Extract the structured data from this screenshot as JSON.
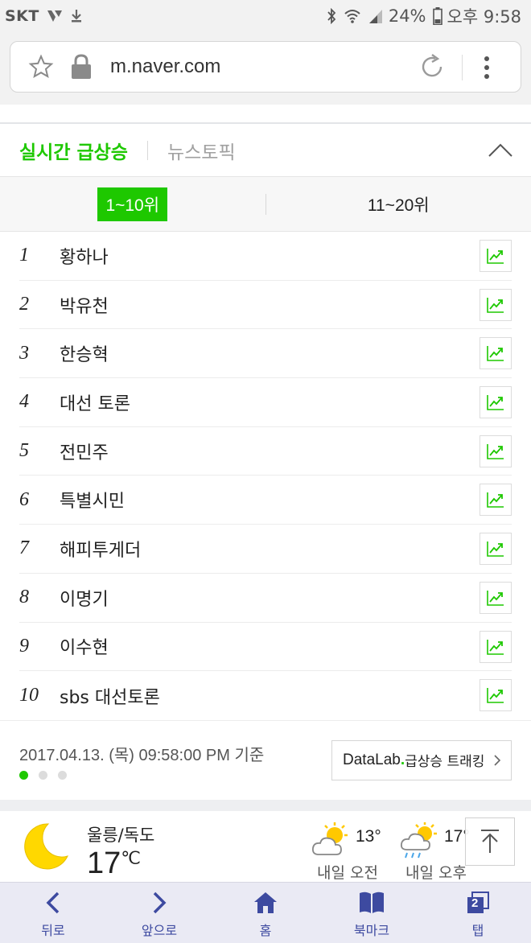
{
  "status_bar": {
    "carrier": "SKT",
    "battery": "24%",
    "time": "오후 9:58"
  },
  "browser": {
    "url": "m.naver.com"
  },
  "realtime": {
    "tab_active": "실시간 급상승",
    "tab_other": "뉴스토픽",
    "range_active": "1~10위",
    "range_other": "11~20위",
    "items": [
      {
        "rank": "1",
        "keyword": "황하나"
      },
      {
        "rank": "2",
        "keyword": "박유천"
      },
      {
        "rank": "3",
        "keyword": "한승혁"
      },
      {
        "rank": "4",
        "keyword": "대선 토론"
      },
      {
        "rank": "5",
        "keyword": "전민주"
      },
      {
        "rank": "6",
        "keyword": "특별시민"
      },
      {
        "rank": "7",
        "keyword": "해피투게더"
      },
      {
        "rank": "8",
        "keyword": "이명기"
      },
      {
        "rank": "9",
        "keyword": "이수현"
      },
      {
        "rank": "10",
        "keyword": "sbs 대선토론"
      }
    ],
    "timestamp": "2017.04.13. (목) 09:58:00 PM 기준",
    "datalab_brand": "DataLab",
    "datalab_label": "급상승 트래킹",
    "accent_color": "#1ec800"
  },
  "weather": {
    "location": "울릉/독도",
    "temp": "17",
    "unit": "℃",
    "forecasts": [
      {
        "temp": "13°",
        "label": "내일 오전",
        "icon": "partly-cloudy-icon"
      },
      {
        "temp": "17°",
        "label": "내일 오후",
        "icon": "rain-sun-icon"
      }
    ]
  },
  "bottom_nav": {
    "back": "뒤로",
    "forward": "앞으로",
    "home": "홈",
    "bookmark": "북마크",
    "tabs": "탭",
    "tab_count": "2"
  }
}
